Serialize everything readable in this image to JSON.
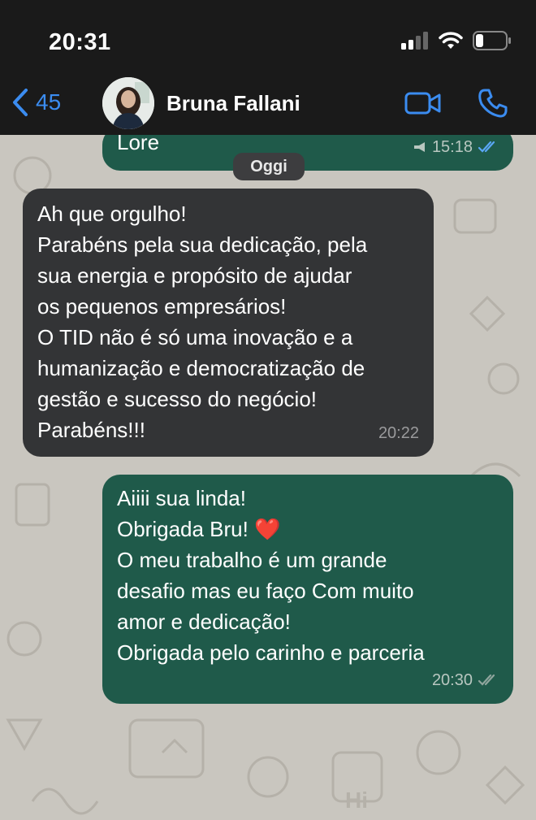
{
  "status": {
    "time": "20:31"
  },
  "header": {
    "back_count": "45",
    "contact_name": "Bruna Fallani"
  },
  "date_separator": "Oggi",
  "messages": [
    {
      "text": "Lore",
      "time": "15:18"
    },
    {
      "text": "Ah que orgulho!\nParabéns pela sua dedicação, pela\nsua energia e propósito de ajudar\nos pequenos empresários!\nO TID não é só uma inovação e a\nhumanização e democratização de\ngestão e sucesso do negócio!\nParabéns!!!",
      "time": "20:22"
    },
    {
      "text": "Aiiii sua linda!\nObrigada Bru! ❤️\nO meu trabalho é um grande\ndesafio mas eu faço Com muito\namor e dedicação!\nObrigada pelo carinho e parceria",
      "time": "20:30"
    }
  ],
  "colors": {
    "accent": "#3b8cf0",
    "outgoing": "#1f5a4a",
    "incoming": "#333436",
    "read_ticks": "#5aa7f5"
  },
  "icons": [
    "signal-icon",
    "wifi-icon",
    "battery-icon",
    "back-chevron-icon",
    "video-call-icon",
    "phone-icon",
    "megaphone-icon",
    "read-receipt-icon"
  ]
}
